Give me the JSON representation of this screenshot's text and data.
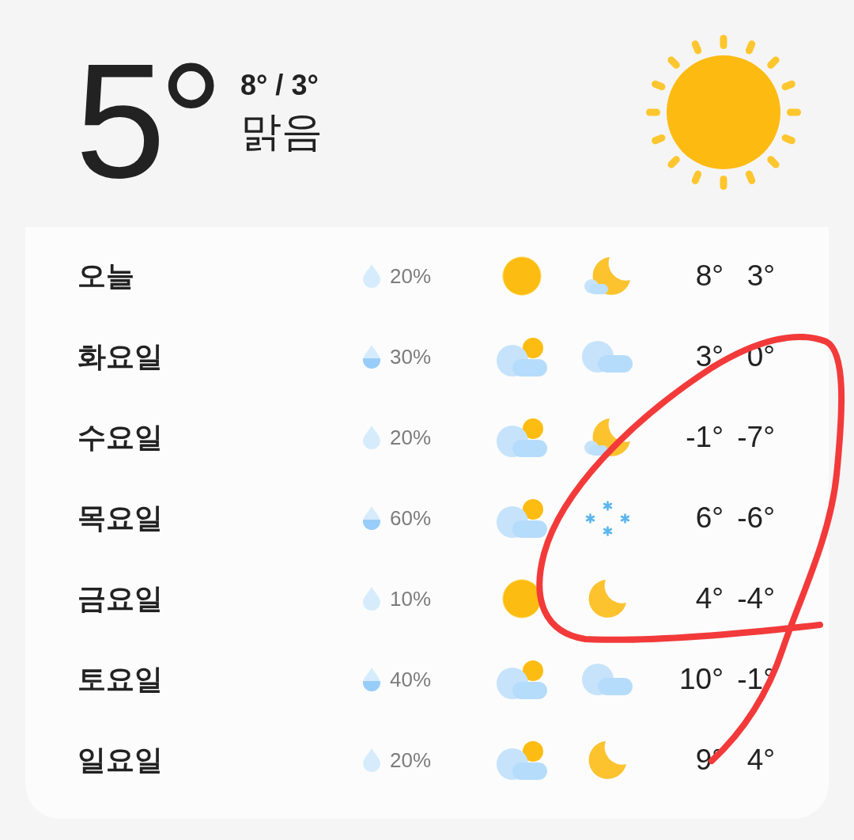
{
  "current": {
    "temperature": "5°",
    "high_low": "8° / 3°",
    "condition": "맑음",
    "weather": {
      "kind": "sun"
    }
  },
  "forecast": [
    {
      "day": "오늘",
      "precipitation": "20%",
      "drop_filled": false,
      "day_weather": {
        "kind": "sun"
      },
      "night_weather": {
        "kind": "moon-cloud"
      },
      "high": "8°",
      "low": "3°"
    },
    {
      "day": "화요일",
      "precipitation": "30%",
      "drop_filled": true,
      "day_weather": {
        "kind": "sun-cloud"
      },
      "night_weather": {
        "kind": "cloud"
      },
      "high": "3°",
      "low": "0°"
    },
    {
      "day": "수요일",
      "precipitation": "20%",
      "drop_filled": false,
      "day_weather": {
        "kind": "sun-cloud"
      },
      "night_weather": {
        "kind": "moon-cloud"
      },
      "high": "-1°",
      "low": "-7°"
    },
    {
      "day": "목요일",
      "precipitation": "60%",
      "drop_filled": true,
      "day_weather": {
        "kind": "sun-cloud"
      },
      "night_weather": {
        "kind": "snow"
      },
      "high": "6°",
      "low": "-6°"
    },
    {
      "day": "금요일",
      "precipitation": "10%",
      "drop_filled": false,
      "day_weather": {
        "kind": "sun"
      },
      "night_weather": {
        "kind": "moon"
      },
      "high": "4°",
      "low": "-4°"
    },
    {
      "day": "토요일",
      "precipitation": "40%",
      "drop_filled": true,
      "day_weather": {
        "kind": "sun-cloud"
      },
      "night_weather": {
        "kind": "cloud"
      },
      "high": "10°",
      "low": "-1°"
    },
    {
      "day": "일요일",
      "precipitation": "20%",
      "drop_filled": false,
      "day_weather": {
        "kind": "sun-cloud"
      },
      "night_weather": {
        "kind": "moon"
      },
      "high": "9°",
      "low": "4°"
    }
  ],
  "annotation": {
    "kind": "freehand"
  }
}
